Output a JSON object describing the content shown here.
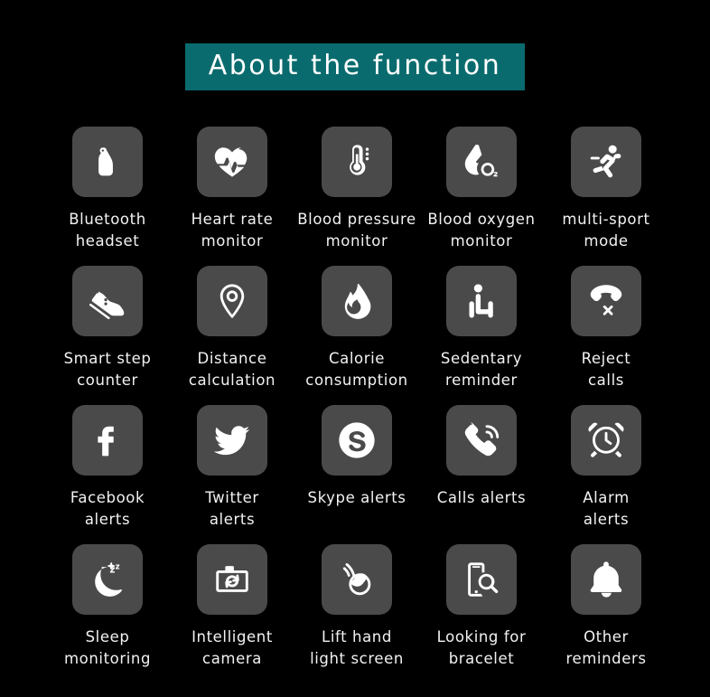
{
  "header": {
    "title": "About  the  function",
    "banner_color": "#0a6b6e"
  },
  "theme": {
    "background": "#000000",
    "tile_background": "#4a4a4a",
    "icon_color": "#ffffff",
    "label_color": "#f2f2f2",
    "accent": "#0a6b6e"
  },
  "features": [
    {
      "icon": "bluetooth-headset-icon",
      "label": "Bluetooth\nheadset"
    },
    {
      "icon": "heart-rate-icon",
      "label": "Heart rate\nmonitor"
    },
    {
      "icon": "thermometer-blood-pressure-icon",
      "label": "Blood pressure\nmonitor"
    },
    {
      "icon": "blood-oxygen-icon",
      "label": "Blood oxygen\nmonitor"
    },
    {
      "icon": "running-multi-sport-icon",
      "label": "multi-sport\nmode"
    },
    {
      "icon": "shoe-step-counter-icon",
      "label": "Smart step\ncounter"
    },
    {
      "icon": "map-pin-distance-icon",
      "label": "Distance\ncalculation"
    },
    {
      "icon": "flame-calorie-icon",
      "label": "Calorie\nconsumption"
    },
    {
      "icon": "sitting-person-sedentary-icon",
      "label": "Sedentary\nreminder"
    },
    {
      "icon": "phone-reject-call-icon",
      "label": "Reject\ncalls"
    },
    {
      "icon": "facebook-icon",
      "label": "Facebook\nalerts"
    },
    {
      "icon": "twitter-bird-icon",
      "label": "Twitter\nalerts"
    },
    {
      "icon": "skype-icon",
      "label": "Skype alerts"
    },
    {
      "icon": "phone-call-ring-icon",
      "label": "Calls alerts"
    },
    {
      "icon": "alarm-clock-icon",
      "label": "Alarm\nalerts"
    },
    {
      "icon": "moon-sleep-icon",
      "label": "Sleep\nmonitoring"
    },
    {
      "icon": "camera-intelligent-icon",
      "label": "Intelligent\ncamera"
    },
    {
      "icon": "lift-hand-light-screen-icon",
      "label": "Lift hand\nlight screen"
    },
    {
      "icon": "phone-search-bracelet-icon",
      "label": "Looking for\nbracelet"
    },
    {
      "icon": "bell-reminder-icon",
      "label": "Other\nreminders"
    }
  ]
}
